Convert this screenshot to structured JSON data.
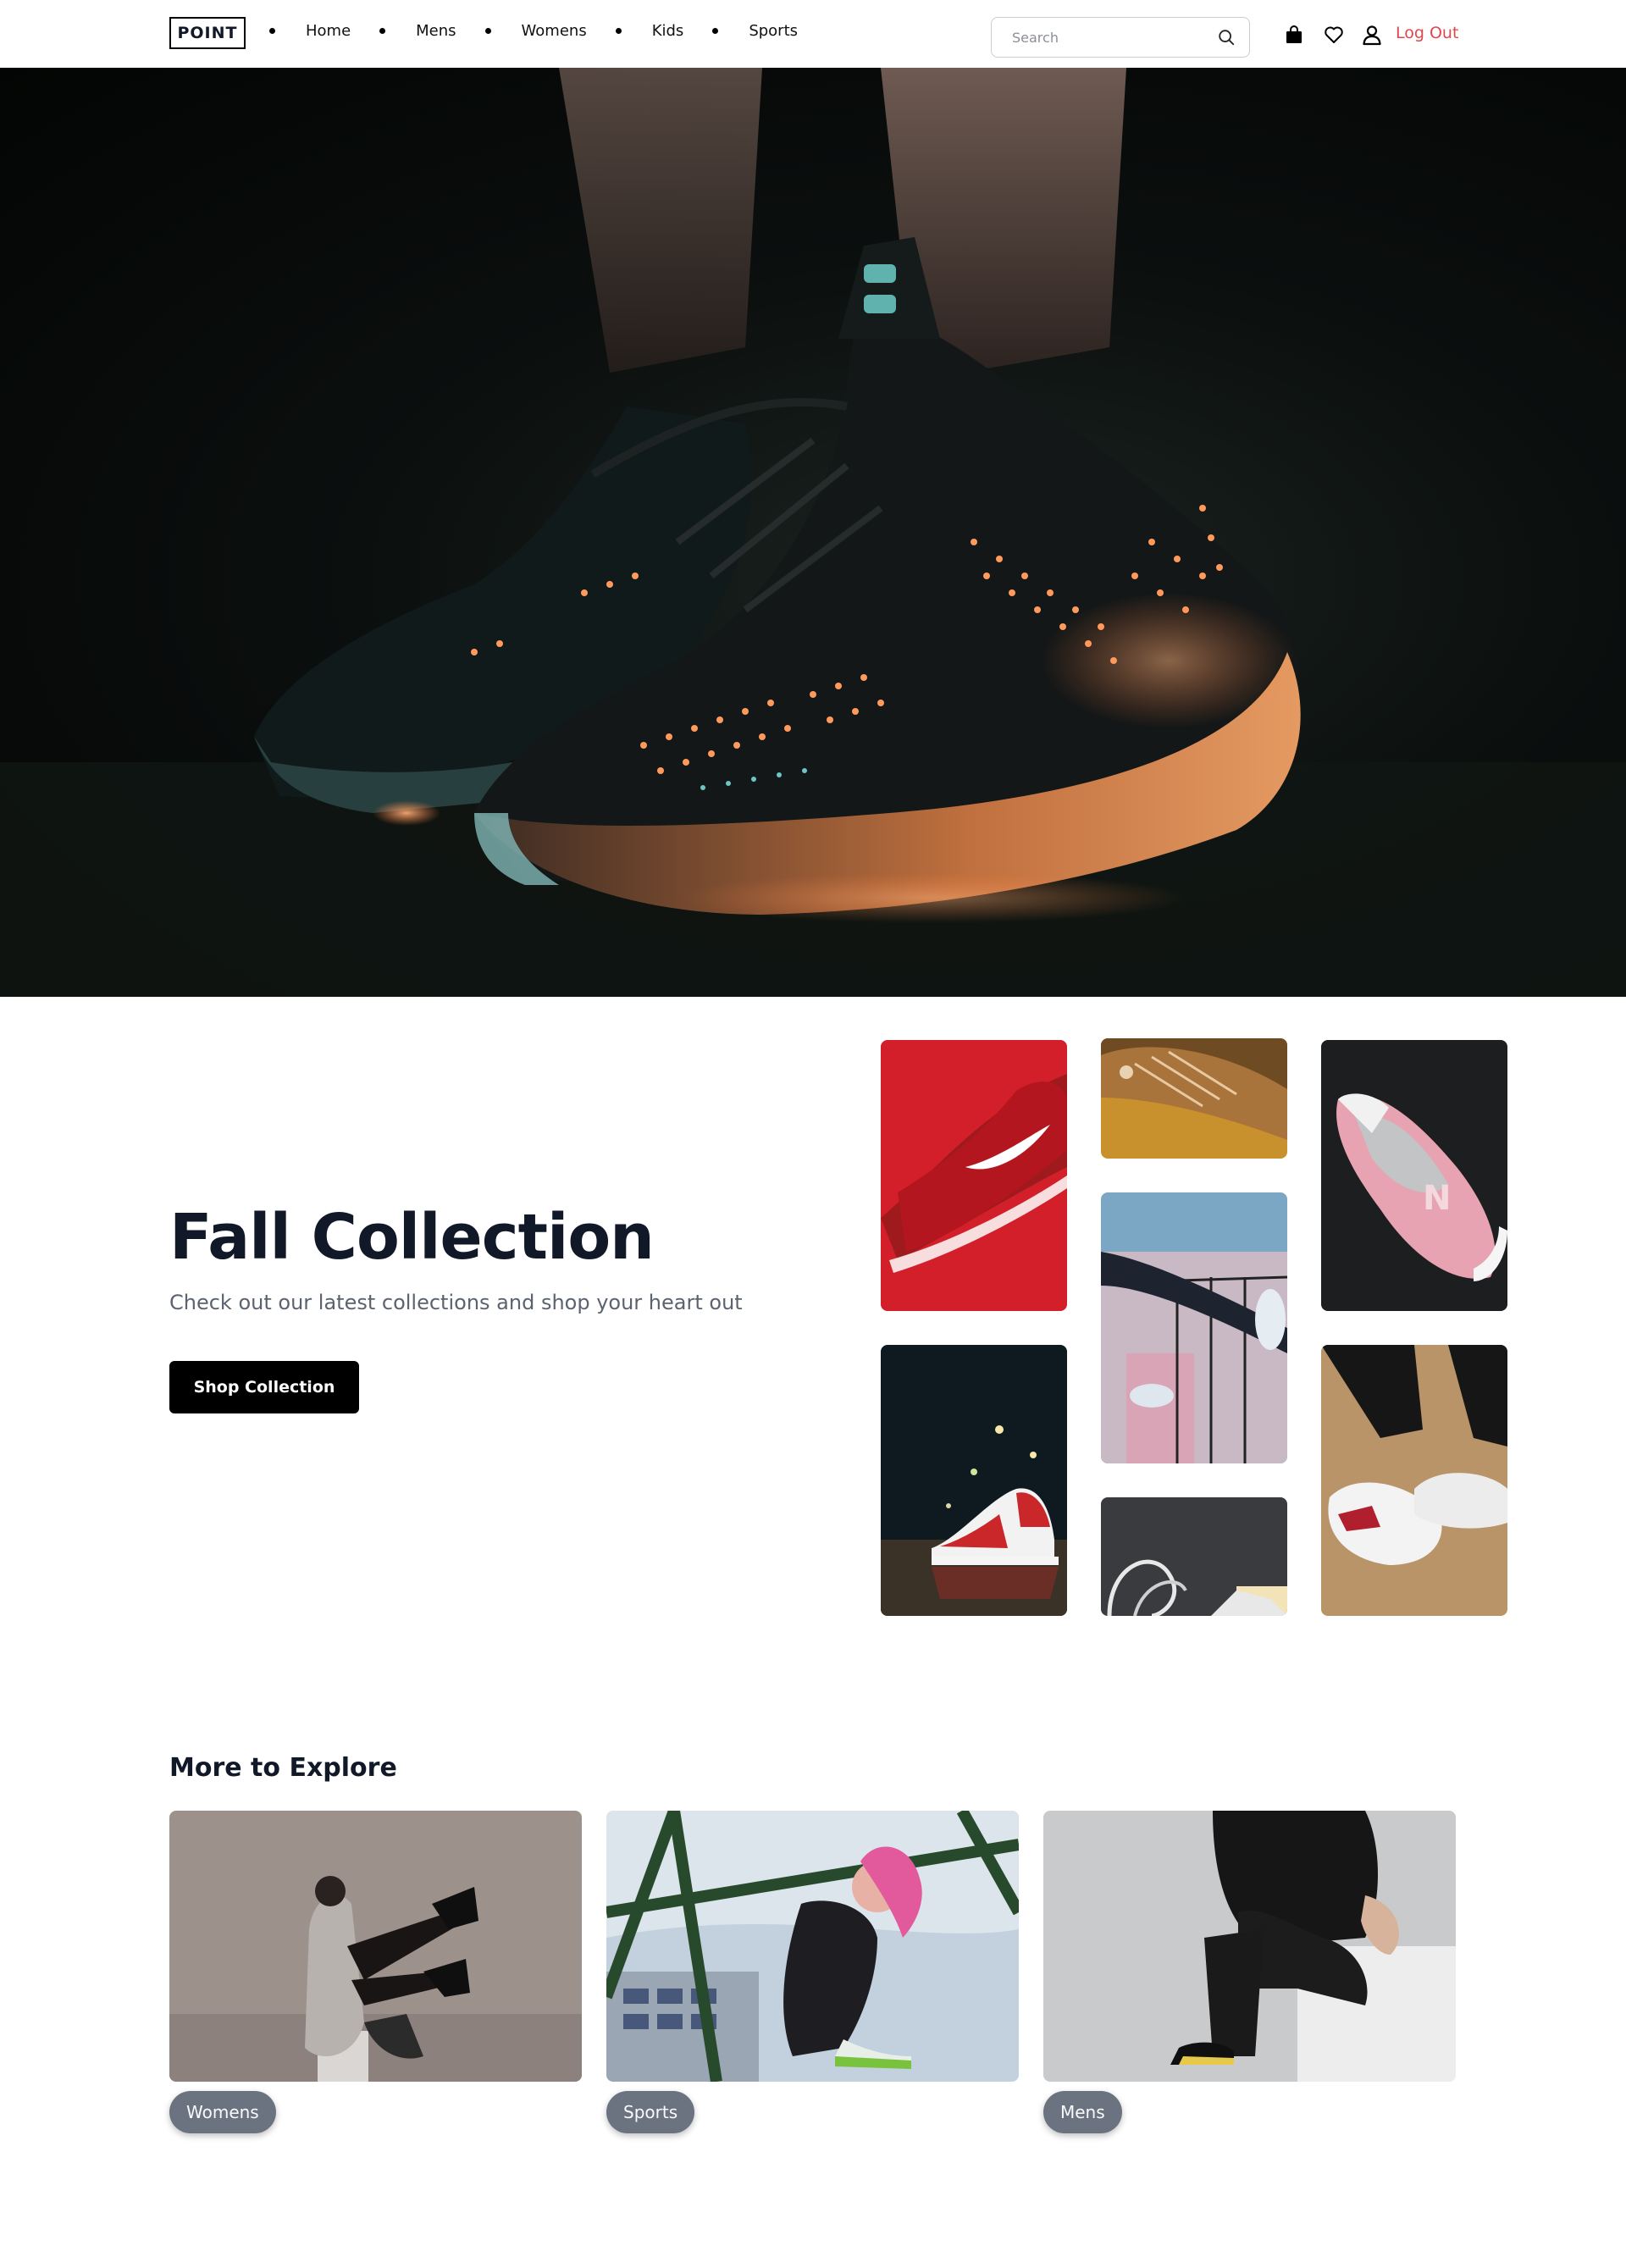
{
  "header": {
    "logo": "POINT",
    "nav": [
      {
        "label": "Home"
      },
      {
        "label": "Mens"
      },
      {
        "label": "Womens"
      },
      {
        "label": "Kids"
      },
      {
        "label": "Sports"
      }
    ],
    "search": {
      "placeholder": "Search",
      "icon": "search-icon"
    },
    "icons": [
      "bag-icon",
      "heart-icon",
      "user-icon"
    ],
    "logout_label": "Log Out",
    "logout_color": "#e0474c"
  },
  "hero": {
    "image": "dark-glowing-sneaker-photo"
  },
  "collection": {
    "title": "Fall Collection",
    "subtitle": "Check out our latest collections and shop your heart out",
    "button_label": "Shop Collection",
    "tiles": [
      "red-nike-sneaker-photo",
      "brown-leather-sneaker-photo",
      "legs-on-balcony-sneaker-photo",
      "white-laces-sneaker-photo",
      "pink-grey-sneaker-photo",
      "red-white-jordan-photo",
      "white-chunky-sneaker-photo"
    ]
  },
  "explore": {
    "title": "More to Explore",
    "cards": [
      {
        "label": "Womens",
        "image": "woman-in-black-boots-photo"
      },
      {
        "label": "Sports",
        "image": "pink-hair-athlete-photo"
      },
      {
        "label": "Mens",
        "image": "man-in-black-outfit-photo"
      }
    ]
  },
  "colors": {
    "text_dark": "#111827",
    "button_bg": "#000000",
    "pill_bg": "#6b7280"
  }
}
